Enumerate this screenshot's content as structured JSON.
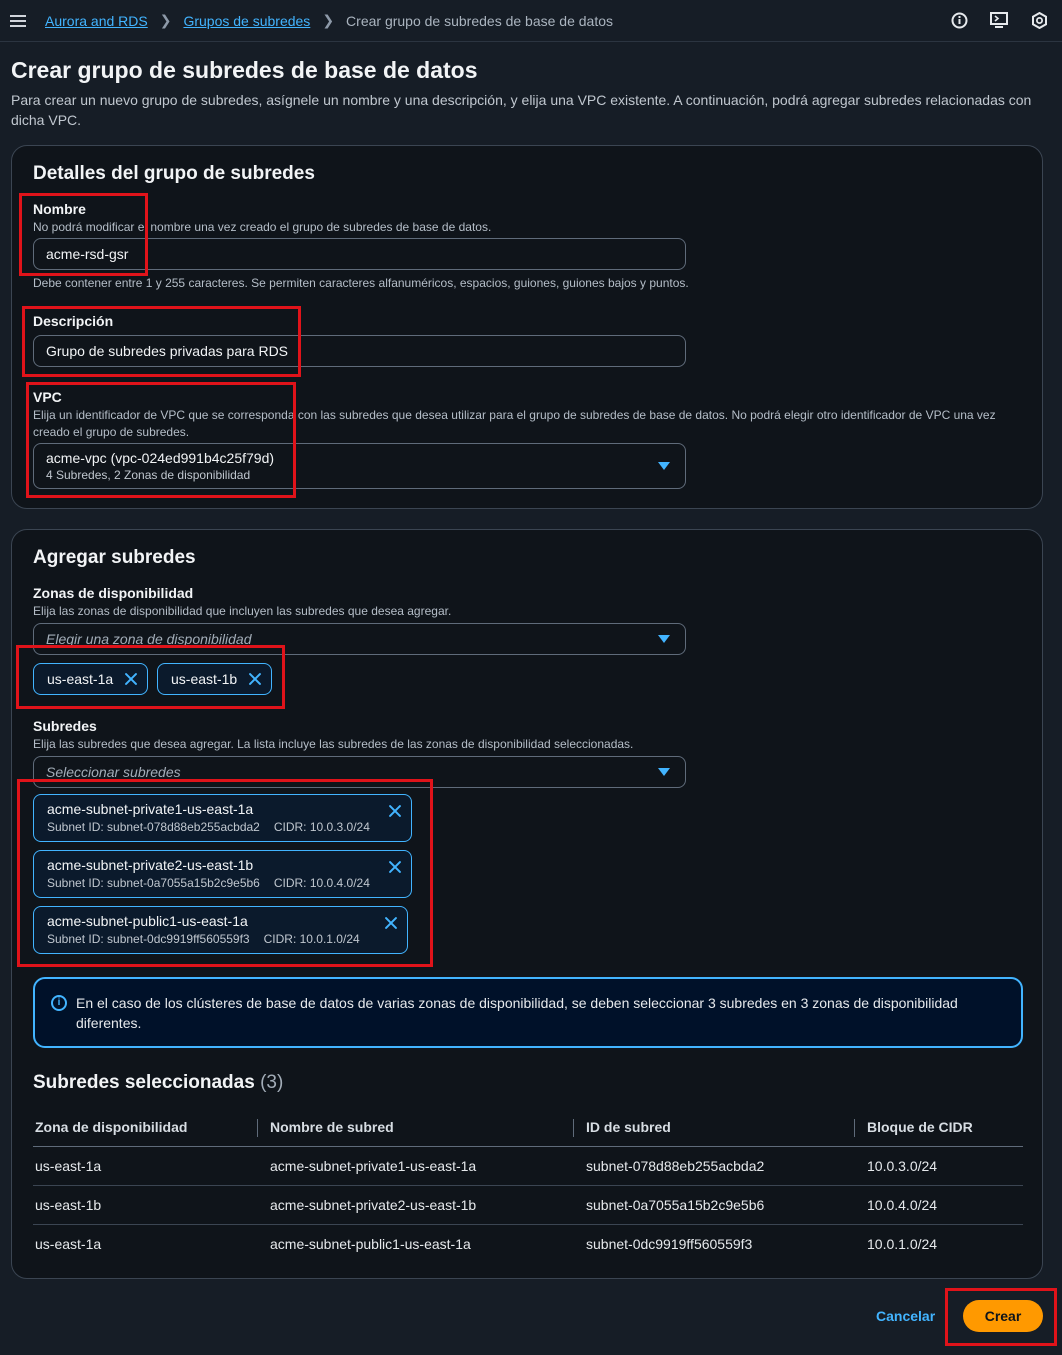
{
  "breadcrumb": {
    "items": [
      "Aurora and RDS",
      "Grupos de subredes"
    ],
    "current": "Crear grupo de subredes de base de datos"
  },
  "page": {
    "title": "Crear grupo de subredes de base de datos",
    "description": "Para crear un nuevo grupo de subredes, asígnele un nombre y una descripción, y elija una VPC existente. A continuación, podrá agregar subredes relacionadas con dicha VPC."
  },
  "details": {
    "title": "Detalles del grupo de subredes",
    "name_label": "Nombre",
    "name_hint": "No podrá modificar el nombre una vez creado el grupo de subredes de base de datos.",
    "name_value": "acme-rsd-gsr",
    "name_constraint": "Debe contener entre 1 y 255 caracteres. Se permiten caracteres alfanuméricos, espacios, guiones, guiones bajos y puntos.",
    "description_label": "Descripción",
    "description_value": "Grupo de subredes privadas para RDS",
    "vpc_label": "VPC",
    "vpc_hint": "Elija un identificador de VPC que se corresponda con las subredes que desea utilizar para el grupo de subredes de base de datos. No podrá elegir otro identificador de VPC una vez creado el grupo de subredes.",
    "vpc_value": "acme-vpc (vpc-024ed991b4c25f79d)",
    "vpc_sub": "4 Subredes, 2 Zonas de disponibilidad"
  },
  "add_subnets": {
    "title": "Agregar subredes",
    "az_label": "Zonas de disponibilidad",
    "az_hint": "Elija las zonas de disponibilidad que incluyen las subredes que desea agregar.",
    "az_placeholder": "Elegir una zona de disponibilidad",
    "az_tokens": [
      "us-east-1a",
      "us-east-1b"
    ],
    "subnets_label": "Subredes",
    "subnets_hint": "Elija las subredes que desea agregar. La lista incluye las subredes de las zonas de disponibilidad seleccionadas.",
    "subnets_placeholder": "Seleccionar subredes",
    "subnet_tokens": [
      {
        "name": "acme-subnet-private1-us-east-1a",
        "id": "Subnet ID: subnet-078d88eb255acbda2",
        "cidr": "CIDR: 10.0.3.0/24"
      },
      {
        "name": "acme-subnet-private2-us-east-1b",
        "id": "Subnet ID: subnet-0a7055a15b2c9e5b6",
        "cidr": "CIDR: 10.0.4.0/24"
      },
      {
        "name": "acme-subnet-public1-us-east-1a",
        "id": "Subnet ID: subnet-0dc9919ff560559f3",
        "cidr": "CIDR: 10.0.1.0/24"
      }
    ],
    "info_text": "En el caso de los clústeres de base de datos de varias zonas de disponibilidad, se deben seleccionar 3 subredes en 3 zonas de disponibilidad diferentes."
  },
  "selected": {
    "title": "Subredes seleccionadas",
    "count": "(3)",
    "columns": [
      "Zona de disponibilidad",
      "Nombre de subred",
      "ID de subred",
      "Bloque de CIDR"
    ],
    "rows": [
      [
        "us-east-1a",
        "acme-subnet-private1-us-east-1a",
        "subnet-078d88eb255acbda2",
        "10.0.3.0/24"
      ],
      [
        "us-east-1b",
        "acme-subnet-private2-us-east-1b",
        "subnet-0a7055a15b2c9e5b6",
        "10.0.4.0/24"
      ],
      [
        "us-east-1a",
        "acme-subnet-public1-us-east-1a",
        "subnet-0dc9919ff560559f3",
        "10.0.1.0/24"
      ]
    ]
  },
  "actions": {
    "cancel": "Cancelar",
    "create": "Crear"
  },
  "colors": {
    "accent": "#42b4ff",
    "primary_button": "#ff9900",
    "highlight": "#e0131a"
  }
}
